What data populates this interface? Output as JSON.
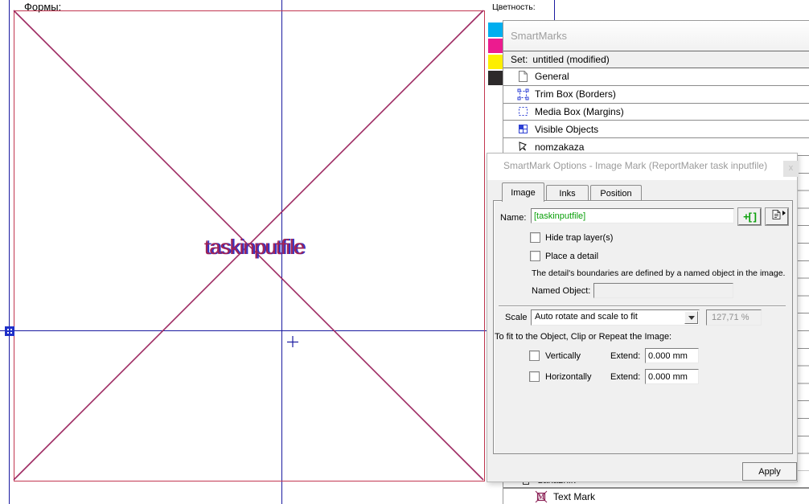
{
  "canvas": {
    "forms_label": "Формы:",
    "placeholder_text": "taskinputfile"
  },
  "color_panel": {
    "label": "Цветность:",
    "swatches": [
      {
        "name": "cyan",
        "color": "#00aeef"
      },
      {
        "name": "magenta",
        "color": "#ec1b8f"
      },
      {
        "name": "yellow",
        "color": "#fdee00"
      },
      {
        "name": "black",
        "color": "#2d2a2b"
      }
    ]
  },
  "smartmarks_palette": {
    "title": "SmartMarks",
    "set_label": "Set:",
    "set_value": "untitled (modified)",
    "items": [
      {
        "label": "General",
        "icon": "document-icon"
      },
      {
        "label": "Trim Box (Borders)",
        "icon": "trim-box-icon"
      },
      {
        "label": "Media Box (Margins)",
        "icon": "media-box-icon"
      },
      {
        "label": "Visible Objects",
        "icon": "visible-objects-icon"
      },
      {
        "label": "nomzakaza",
        "icon": "lasso-icon"
      }
    ],
    "bottom_items": [
      {
        "label": "zakaznik",
        "icon": "mark-icon",
        "occluded": true
      },
      {
        "label": "Text Mark",
        "icon": "text-mark-icon"
      }
    ]
  },
  "dialog": {
    "title": "SmartMark Options - Image Mark (ReportMaker task inputfile)",
    "close_label": "x",
    "tabs": [
      {
        "label": "Image",
        "active": true
      },
      {
        "label": "Inks",
        "active": false
      },
      {
        "label": "Position",
        "active": false
      }
    ],
    "name_label": "Name:",
    "name_value": "[taskinputfile]",
    "name_value_color": "#0aa00a",
    "insert_bracket_button": "+[ ]",
    "hide_trap_label": "Hide trap layer(s)",
    "place_detail_label": "Place a detail",
    "detail_note": "The detail's boundaries are defined by a named object in the image.",
    "named_object_label": "Named Object:",
    "named_object_value": "",
    "scale_label": "Scale",
    "scale_value": "Auto rotate and scale to fit",
    "scale_percent": "127,71 %",
    "fit_note": "To fit to the Object, Clip or Repeat the Image:",
    "vertically_label": "Vertically",
    "horizontally_label": "Horizontally",
    "extend_label": "Extend:",
    "extend_v_value": "0.000 mm",
    "extend_h_value": "0.000 mm",
    "apply_label": "Apply"
  },
  "colors": {
    "guide_blue": "#1a1aa0",
    "frame_red": "#c23650",
    "diagonal_maroon": "#9e2a62",
    "overprint_blue": "#3434c8",
    "placeholder_text": "#a12355",
    "text_mark_maroon": "#8b2155"
  }
}
